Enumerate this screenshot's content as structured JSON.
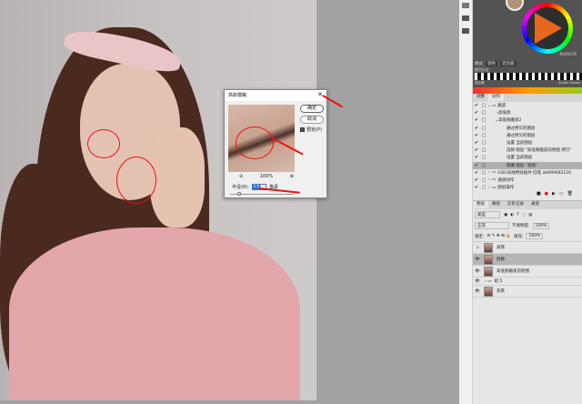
{
  "dialog": {
    "title": "高斯模糊",
    "ok": "确定",
    "cancel": "取消",
    "preview_label": "预览(P)",
    "zoom": "100%",
    "radius_label": "半径(R):",
    "radius_value": "3.0",
    "unit": "像素"
  },
  "color_panel": {
    "hex": "#b39178",
    "modes_label": "模式",
    "mode1": "调色",
    "mode2": "混合器",
    "history_label": "颜色历史",
    "mix_label": "混合器",
    "swatch_label": "Studio Sweep"
  },
  "actions_panel": {
    "tabs": [
      "调整",
      "动作"
    ],
    "items": [
      {
        "label": "磨皮",
        "level": 0,
        "expanded": true
      },
      {
        "label": "高低频",
        "level": 1
      },
      {
        "label": "高低频磨皮2",
        "level": 1,
        "expanded": true
      },
      {
        "label": "通过拷贝的图层",
        "level": 2
      },
      {
        "label": "通过拷贝的图层",
        "level": 2
      },
      {
        "label": "设置 当前图层",
        "level": 2
      },
      {
        "label": "选择 图层 \"高低频磨皮前原图 拷贝\"",
        "level": 2
      },
      {
        "label": "设置 当前图层",
        "level": 2
      },
      {
        "label": "隐藏 图层 \"高频\"",
        "level": 2,
        "selected": true
      },
      {
        "label": "GOG光线特效插件 旺旺 ab999482120",
        "level": 0
      },
      {
        "label": "通道动作",
        "level": 0
      },
      {
        "label": "图层操作",
        "level": 0
      }
    ]
  },
  "layers_panel": {
    "tabs": [
      "图层",
      "路径",
      "历史记录",
      "通道"
    ],
    "filter": "类型",
    "blend": "正常",
    "opacity_label": "不透明度:",
    "opacity": "100%",
    "lock_label": "锁定:",
    "fill_label": "填充:",
    "fill": "100%",
    "layers": [
      {
        "name": "高频",
        "visible": false
      },
      {
        "name": "低频",
        "visible": true,
        "selected": true
      },
      {
        "name": "高低频磨皮前原图",
        "visible": true
      },
      {
        "name": "组 5",
        "visible": true,
        "group": true
      },
      {
        "name": "背景",
        "visible": true
      }
    ]
  }
}
